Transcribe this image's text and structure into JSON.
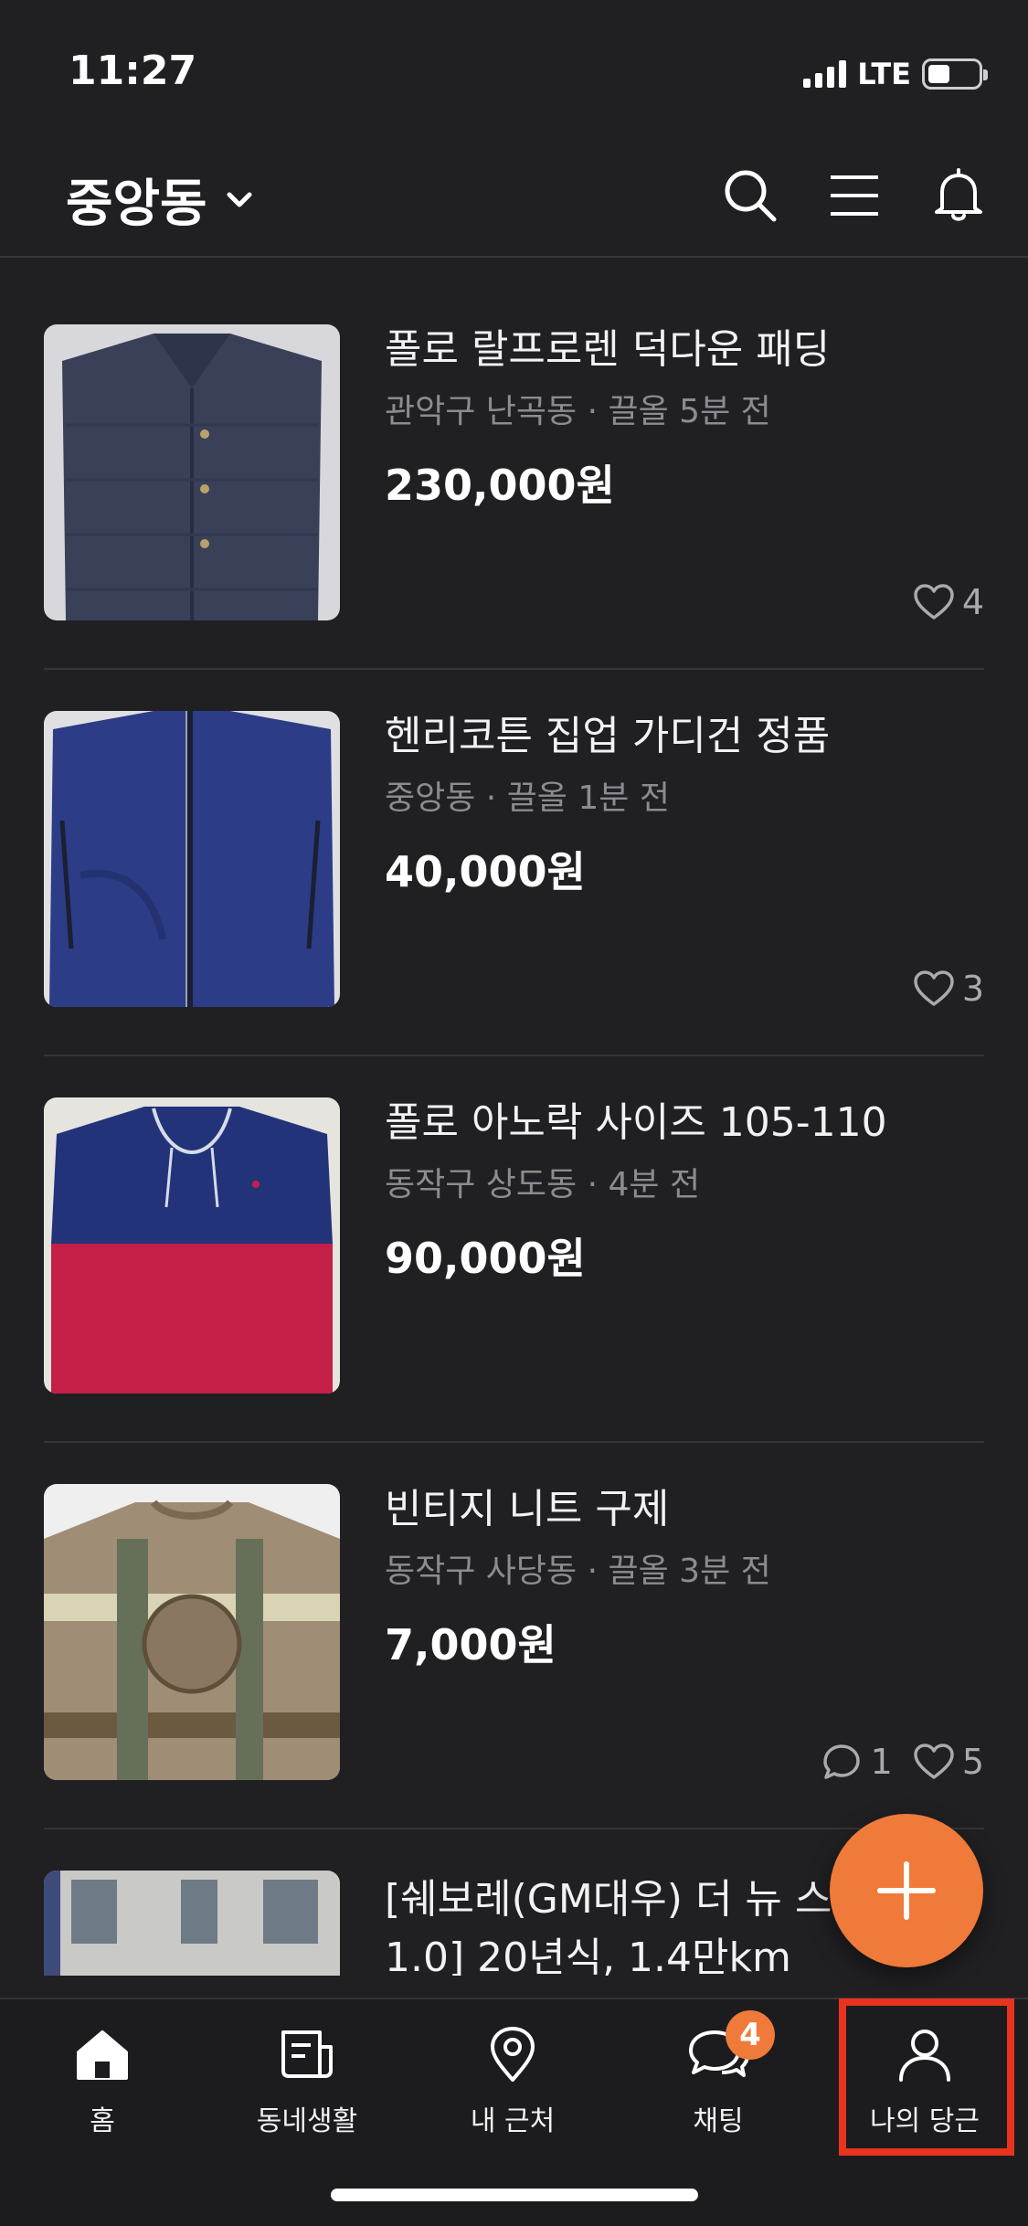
{
  "status_bar": {
    "time": "11:27",
    "network": "LTE"
  },
  "header": {
    "location": "중앙동"
  },
  "listings": [
    {
      "title": "폴로 랄프로렌 덕다운 패딩",
      "meta": "관악구 난곡동 · 끌올 5분 전",
      "price": "230,000원",
      "comments": "",
      "likes": "4",
      "thumb_colors": [
        "#3a4058",
        "#2c3146"
      ]
    },
    {
      "title": "헨리코튼 집업 가디건 정품",
      "meta": "중앙동 · 끌올 1분 전",
      "price": "40,000원",
      "comments": "",
      "likes": "3",
      "thumb_colors": [
        "#2c3c86",
        "#23306b"
      ]
    },
    {
      "title": "폴로 아노락 사이즈 105-110",
      "meta": "동작구 상도동 · 4분 전",
      "price": "90,000원",
      "comments": "",
      "likes": "",
      "thumb_colors": [
        "#23337a",
        "#c51f47"
      ]
    },
    {
      "title": "빈티지 니트 구제",
      "meta": "동작구 사당동 · 끌올 3분 전",
      "price": "7,000원",
      "comments": "1",
      "likes": "5",
      "thumb_colors": [
        "#a08d76",
        "#7a6a54"
      ]
    },
    {
      "title": "[쉐보레(GM대우) 더 뉴 스 M400 1.0] 20년식, 1.4만km",
      "meta": "",
      "price": "",
      "comments": "",
      "likes": "",
      "thumb_colors": [
        "#9a9a9c",
        "#6e6e72"
      ]
    }
  ],
  "tabs": [
    {
      "label": "홈",
      "icon": "home-icon"
    },
    {
      "label": "동네생활",
      "icon": "news-icon"
    },
    {
      "label": "내 근처",
      "icon": "location-pin-icon"
    },
    {
      "label": "채팅",
      "icon": "chat-icon",
      "badge": "4"
    },
    {
      "label": "나의 당근",
      "icon": "person-icon"
    }
  ],
  "colors": {
    "accent": "#f07a3a",
    "background": "#202023",
    "highlight": "#e8331e"
  }
}
